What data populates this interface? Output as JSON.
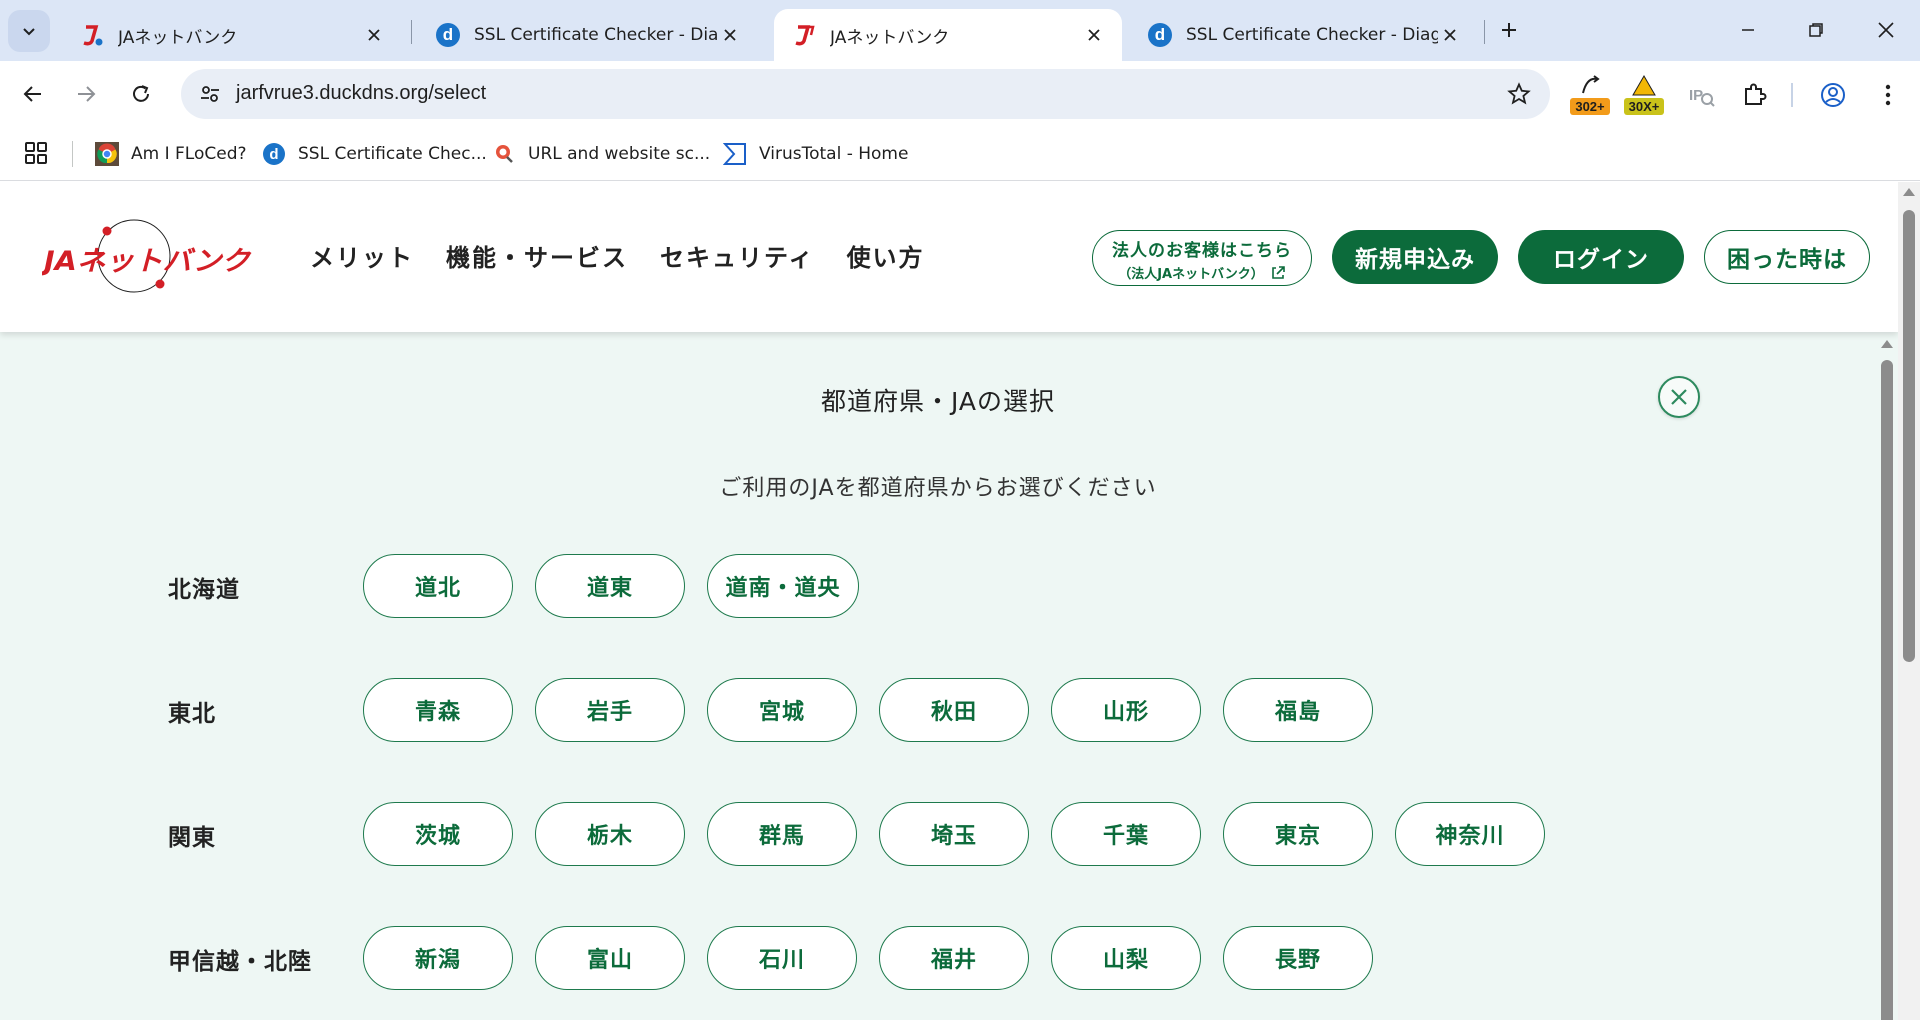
{
  "browser": {
    "tabs": [
      {
        "title": "JAネットバンク",
        "favicon": "ja-logo-icon",
        "active": false
      },
      {
        "title": "SSL Certificate Checker - Diagnostic Tool",
        "favicon": "d-icon",
        "active": false
      },
      {
        "title": "JAネットバンク",
        "favicon": "ja-logo-icon",
        "active": true
      },
      {
        "title": "SSL Certificate Checker - Diagnostic Tool",
        "favicon": "d-icon",
        "active": false
      }
    ],
    "url": "jarfvrue3.duckdns.org/select",
    "extensions": [
      {
        "name": "redirect-counter-icon",
        "badge": "302+",
        "badge_color": "#f29b1a"
      },
      {
        "name": "redirect-path-icon",
        "badge": "30X+",
        "badge_color": "#c9c21a"
      },
      {
        "name": "ip-icon",
        "badge": ""
      }
    ],
    "bookmarks": [
      {
        "label": "Am I FLoCed?",
        "icon": "chrome-icon"
      },
      {
        "label": "SSL Certificate Chec...",
        "icon": "d-icon"
      },
      {
        "label": "URL and website sc...",
        "icon": "urlscan-icon"
      },
      {
        "label": "VirusTotal - Home",
        "icon": "virustotal-icon"
      }
    ]
  },
  "site": {
    "brand_color": "#0c6b3b",
    "logo_text": "JAネットバンク",
    "nav": [
      "メリット",
      "機能・サービス",
      "セキュリティ",
      "使い方"
    ],
    "corporate_button": {
      "line1": "法人のお客様はこちら",
      "line2": "（法人JAネットバンク）"
    },
    "signup_label": "新規申込み",
    "login_label": "ログイン",
    "help_label": "困った時は"
  },
  "modal": {
    "title": "都道府県・JAの選択",
    "subtitle": "ご利用のJAを都道府県からお選びください",
    "regions": [
      {
        "name": "北海道",
        "prefectures": [
          "道北",
          "道東",
          "道南・道央"
        ]
      },
      {
        "name": "東北",
        "prefectures": [
          "青森",
          "岩手",
          "宮城",
          "秋田",
          "山形",
          "福島"
        ]
      },
      {
        "name": "関東",
        "prefectures": [
          "茨城",
          "栃木",
          "群馬",
          "埼玉",
          "千葉",
          "東京",
          "神奈川"
        ]
      },
      {
        "name": "甲信越・北陸",
        "prefectures": [
          "新潟",
          "富山",
          "石川",
          "福井",
          "山梨",
          "長野"
        ]
      }
    ]
  }
}
